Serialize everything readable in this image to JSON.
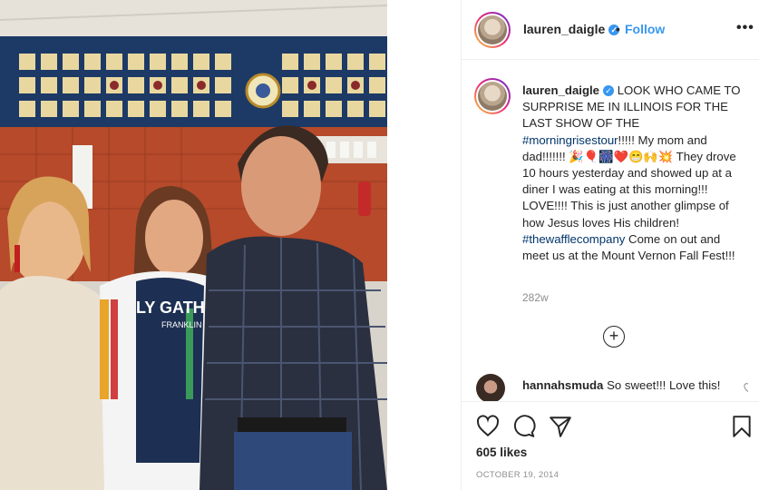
{
  "post": {
    "username": "lauren_daigle",
    "follow_separator": "•",
    "follow_label": "Follow",
    "more_label": "•••",
    "caption": {
      "username": "lauren_daigle",
      "text_1": " LOOK WHO CAME TO SURPRISE ME IN ILLINOIS FOR THE LAST SHOW OF THE ",
      "hashtag_1": "#morningrisestour",
      "text_2": "!!!!! My mom and dad!!!!!!! 🎉🎈🎆❤️😁🙌💥 They drove 10 hours yesterday and showed up at a diner I was eating at this morning!!! LOVE!!!! This is just another glimpse of how Jesus loves His children! ",
      "hashtag_2": "#thewafflecompany",
      "text_3": " Come on out and meet us at the Mount Vernon Fall Fest!!!"
    },
    "age": "282w",
    "comment": {
      "username": "hannahsmuda",
      "text": " So sweet!!! Love this!"
    },
    "likes": "605 likes",
    "date": "OCTOBER 19, 2014"
  },
  "photo": {
    "shirt_text_1": "LY GATHER",
    "shirt_text_2": "FRANKLIN"
  },
  "icons": {
    "verified": "verified-badge-icon",
    "more": "more-options-icon",
    "load_more": "plus-circle-icon",
    "like": "heart-icon",
    "comment": "comment-icon",
    "share": "share-icon",
    "save": "bookmark-icon"
  },
  "colors": {
    "link": "#3897f0",
    "hashtag": "#003569",
    "muted": "#8e8e8e",
    "text": "#262626"
  }
}
